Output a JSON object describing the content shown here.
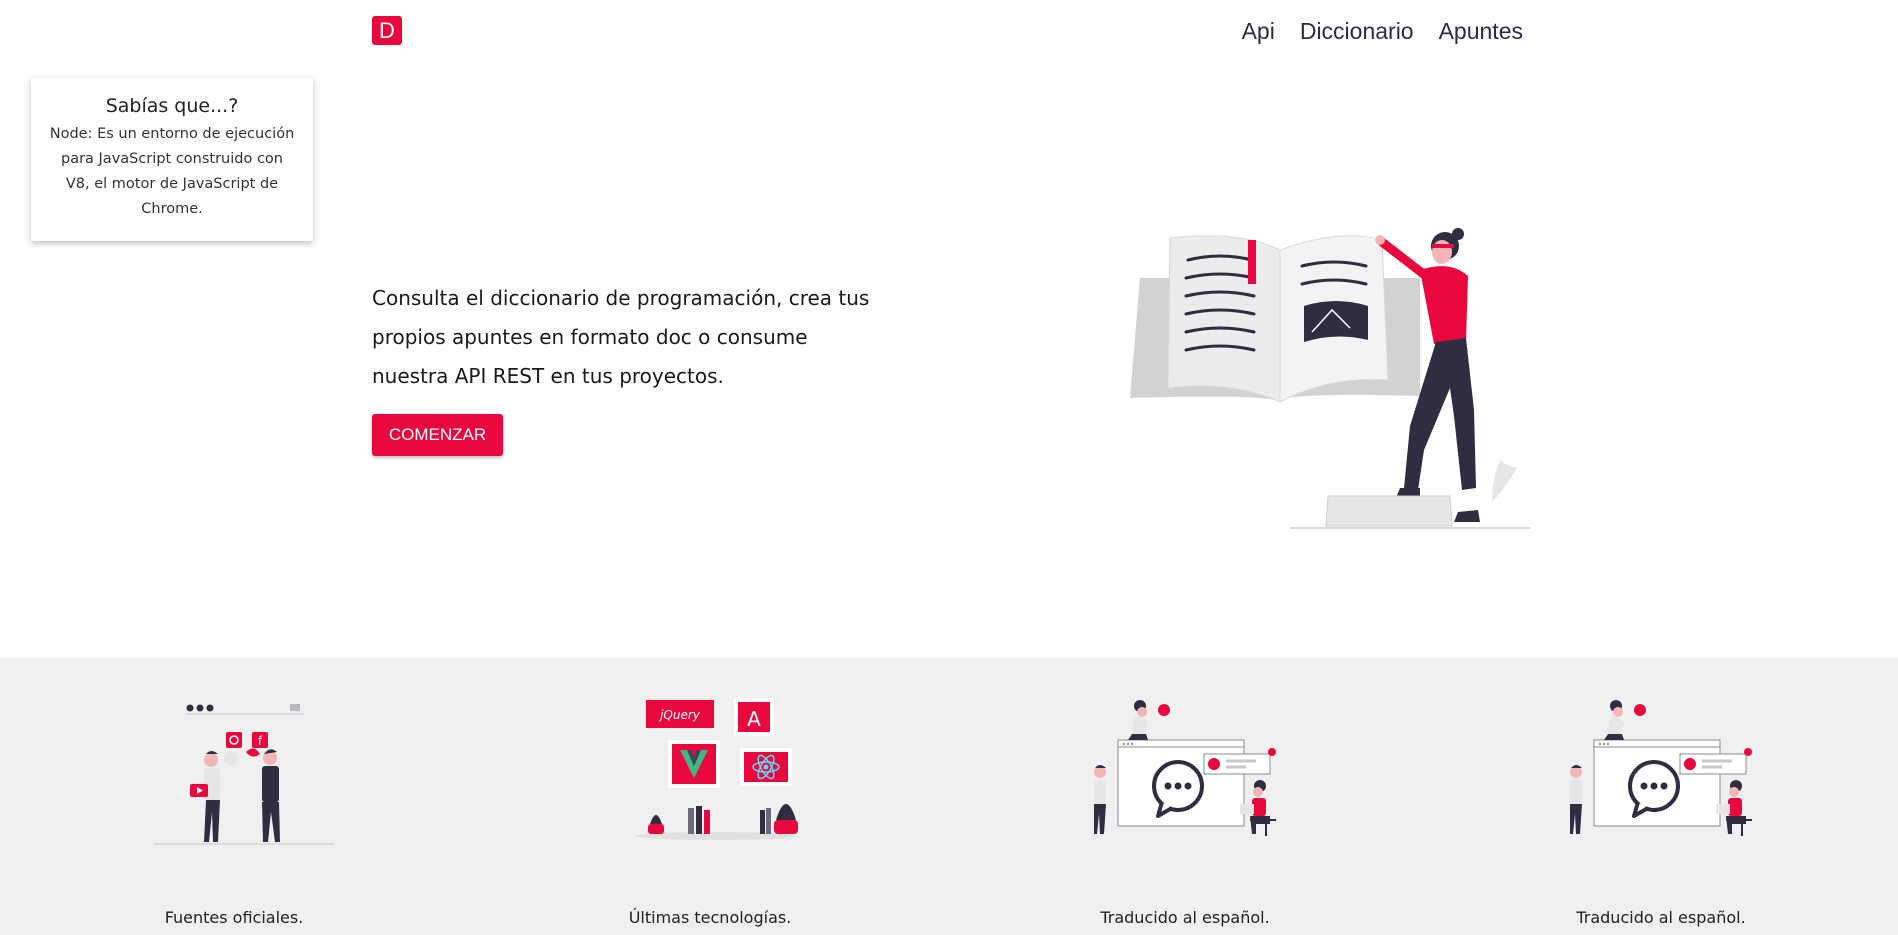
{
  "header": {
    "logo_letter": "D",
    "nav": [
      {
        "label": "Api"
      },
      {
        "label": "Diccionario"
      },
      {
        "label": "Apuntes"
      }
    ]
  },
  "tip": {
    "title": "Sabías que...?",
    "body": "Node: Es un entorno de ejecución para JavaScript construido con V8, el motor de JavaScript de Chrome."
  },
  "hero": {
    "description": "Consulta el diccionario de programación, crea tus propios apuntes en formato doc o consume nuestra API REST en tus proyectos.",
    "cta_label": "COMENZAR"
  },
  "features": [
    {
      "label": "Fuentes oficiales.",
      "icon": "social-sources-illustration"
    },
    {
      "label": "Últimas tecnologías.",
      "icon": "technologies-illustration"
    },
    {
      "label": "Traducido al español.",
      "icon": "chat-translation-illustration"
    },
    {
      "label": "Traducido al español.",
      "icon": "chat-translation-illustration"
    }
  ],
  "illustration_icons": {
    "jquery_label": "jQuery",
    "angular_letter": "A"
  },
  "colors": {
    "accent": "#e8083e",
    "dark": "#2f2e41",
    "feature_bg": "#f1f0f1"
  }
}
